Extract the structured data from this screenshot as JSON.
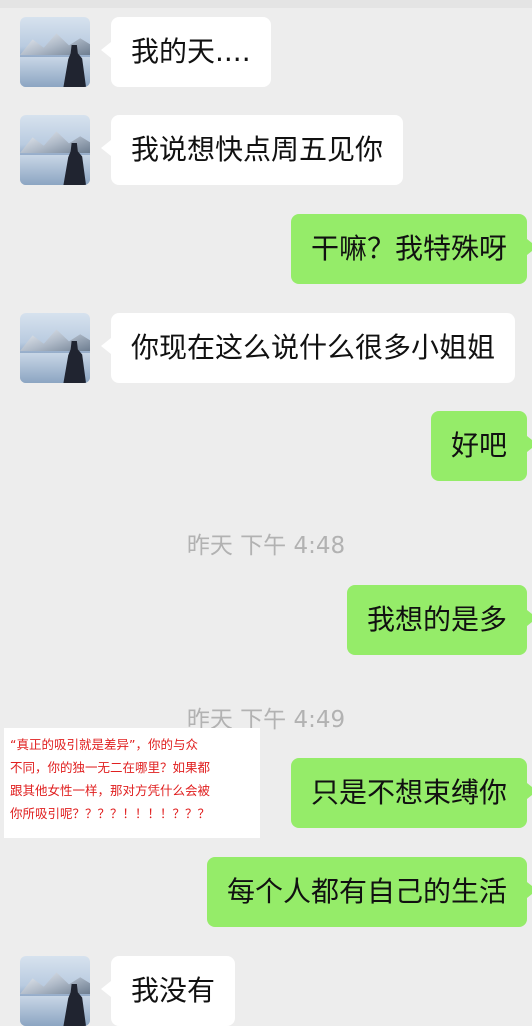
{
  "messages": [
    {
      "side": "left",
      "text": "我的天...."
    },
    {
      "side": "left",
      "text": "我说想快点周五见你"
    },
    {
      "side": "right",
      "text": "干嘛？我特殊呀"
    },
    {
      "side": "left",
      "text": "你现在这么说什么很多小姐姐"
    },
    {
      "side": "right",
      "text": "好吧"
    },
    {
      "side": "time",
      "text": "昨天 下午 4:48"
    },
    {
      "side": "right",
      "text": "我想的是多"
    },
    {
      "side": "time",
      "text": "昨天 下午 4:49"
    },
    {
      "side": "right",
      "text": "只是不想束缚你"
    },
    {
      "side": "right",
      "text": "每个人都有自己的生活"
    },
    {
      "side": "left",
      "text": "我没有"
    }
  ],
  "annotation": {
    "lines": [
      "“真正的吸引就是差异”，你的与众",
      "不同，你的独一无二在哪里？如果都",
      "跟其他女性一样，那对方凭什么会被",
      "你所吸引呢？？？？！！！！？？？"
    ],
    "color": "#e02020"
  },
  "colors": {
    "background": "#ededed",
    "sent_bubble": "#95ec69",
    "received_bubble": "#ffffff",
    "timestamp": "#b2b2b2"
  },
  "icons": {
    "avatar": "avatar-lake-mountain-person"
  }
}
